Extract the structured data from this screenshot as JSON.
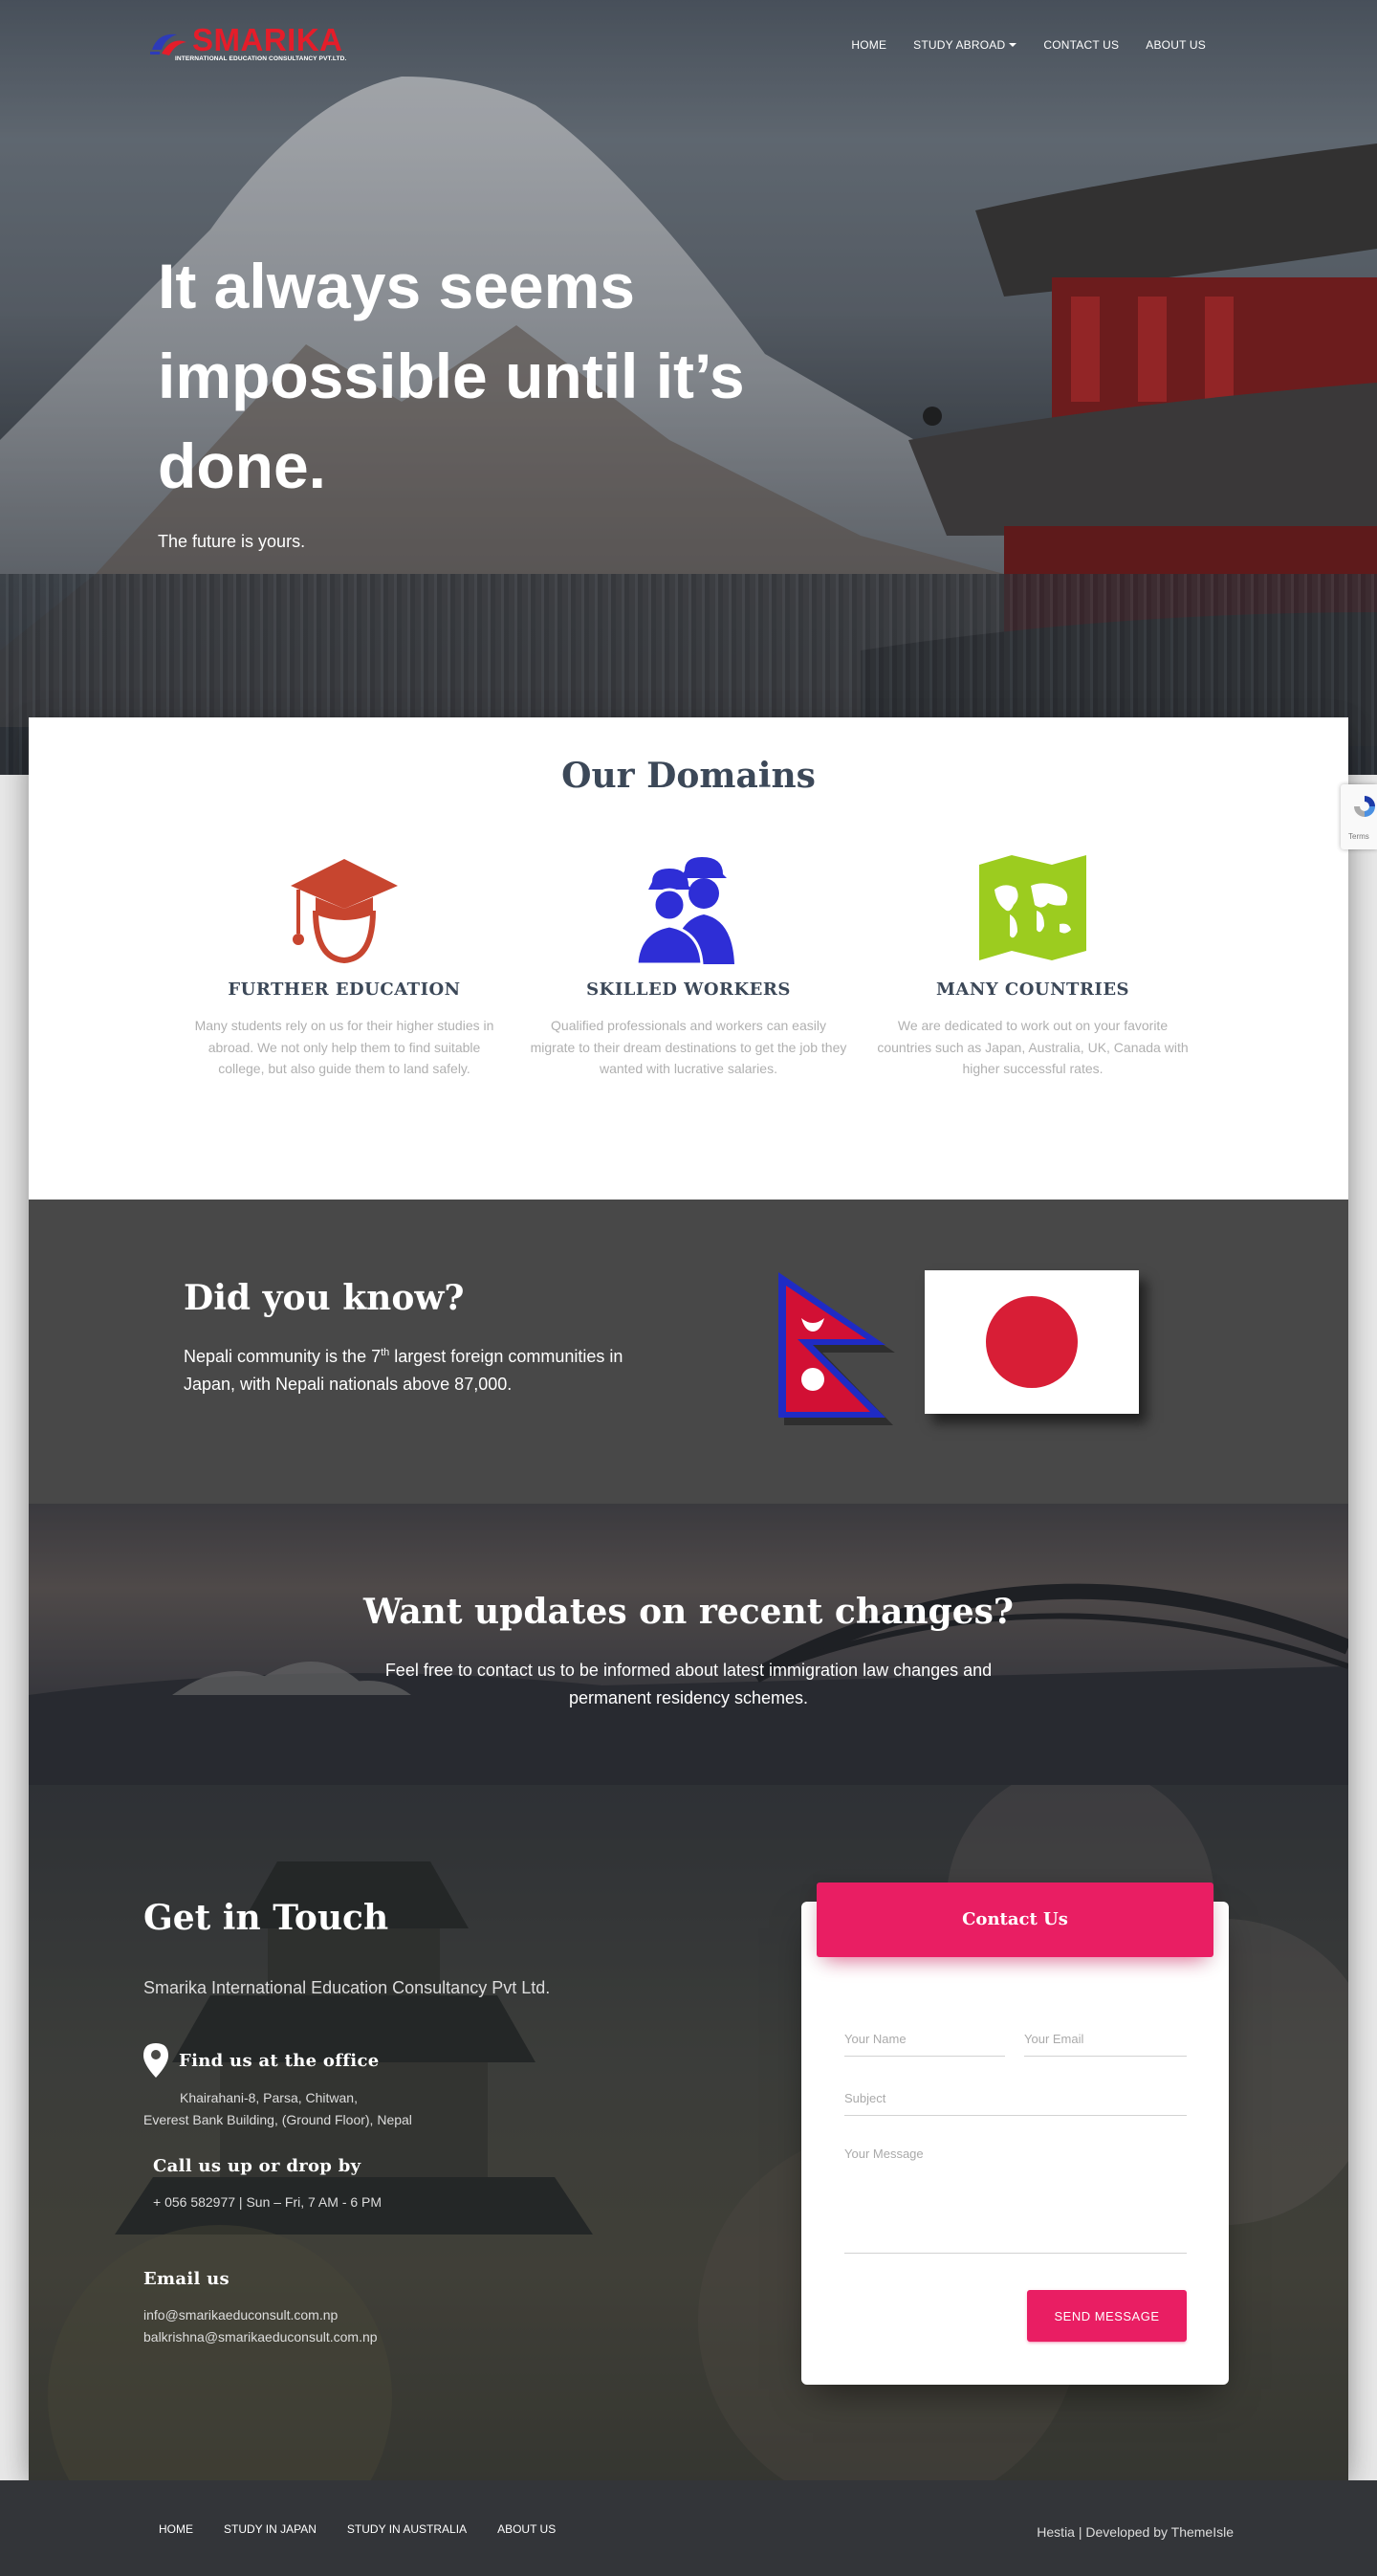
{
  "nav": {
    "logo_name": "SMARIKA",
    "logo_tagline": "INTERNATIONAL EDUCATION CONSULTANCY PVT.LTD.",
    "items": [
      {
        "label": "HOME"
      },
      {
        "label": "STUDY ABROAD"
      },
      {
        "label": "CONTACT US"
      },
      {
        "label": "ABOUT US"
      }
    ]
  },
  "hero": {
    "title": "It always seems impossible until it’s done.",
    "subtitle": "The future is yours."
  },
  "domains": {
    "heading": "Our Domains",
    "items": [
      {
        "title": "FURTHER EDUCATION",
        "text": "Many students rely on us for their higher studies in abroad. We not only help them to find suitable college, but also guide them to land safely.",
        "icon": "graduate-icon",
        "color": "#c7452f"
      },
      {
        "title": "SKILLED WORKERS",
        "text": "Qualified professionals and workers can easily migrate to their dream destinations to get the job they wanted with lucrative salaries.",
        "icon": "workers-icon",
        "color": "#2e2ed6"
      },
      {
        "title": "MANY COUNTRIES",
        "text": "We are dedicated to work out on your favorite countries such as Japan, Australia, UK, Canada with higher successful rates.",
        "icon": "world-map-icon",
        "color": "#9ccc1f"
      }
    ]
  },
  "didyouknow": {
    "heading": "Did you know?",
    "text_before": "Nepali community is the 7",
    "text_sup": "th",
    "text_after": " largest foreign communities in Japan, with Nepali nationals above 87,000."
  },
  "updates": {
    "heading": "Want updates on recent changes?",
    "text": "Feel free to contact us to be informed about latest immigration law changes and permanent residency schemes."
  },
  "contact": {
    "heading": "Get in Touch",
    "company": "Smarika International Education Consultancy Pvt Ltd.",
    "office_title": "Find us at the office",
    "office_line1": "Khairahani-8, Parsa, Chitwan,",
    "office_line2": "Everest Bank Building, (Ground Floor), Nepal",
    "call_title": "Call us up or drop by",
    "call_line": "+ 056 582977 | Sun – Fri, 7 AM - 6 PM",
    "email_title": "Email us",
    "email1": "info@smarikaeduconsult.com.np",
    "email2": "balkrishna@smarikaeduconsult.com.np",
    "form": {
      "header": "Contact Us",
      "name_placeholder": "Your Name",
      "email_placeholder": "Your Email",
      "subject_placeholder": "Subject",
      "message_placeholder": "Your Message",
      "submit_label": "SEND MESSAGE"
    }
  },
  "recaptcha": {
    "terms": "Terms"
  },
  "footer": {
    "links": [
      {
        "label": "HOME"
      },
      {
        "label": "STUDY IN JAPAN"
      },
      {
        "label": "STUDY IN AUSTRALIA"
      },
      {
        "label": "ABOUT US"
      }
    ],
    "credit_prefix": "Hestia | Developed by ",
    "credit_link": "ThemeIsle"
  }
}
